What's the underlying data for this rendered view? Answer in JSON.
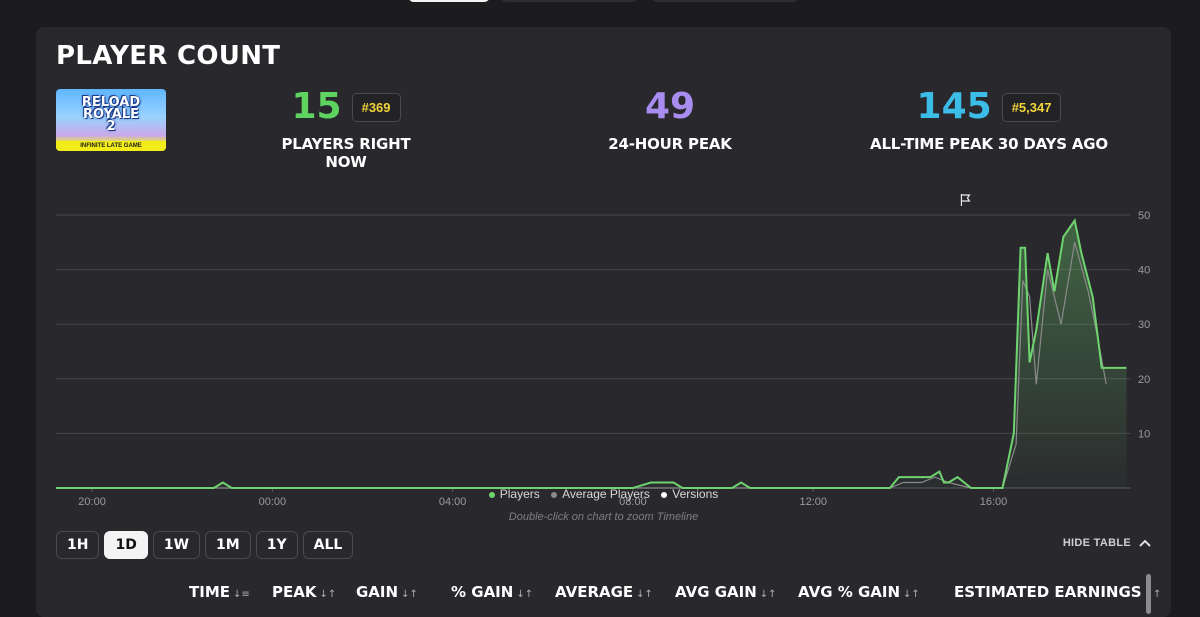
{
  "top_tabs": [
    {
      "active": true
    },
    {
      "active": false
    },
    {
      "active": false
    }
  ],
  "card": {
    "title": "PLAYER COUNT",
    "thumbnail": {
      "title_line1": "RELOAD",
      "title_line2": "ROYALE",
      "title_line3": "2",
      "subtitle": "INFINITE LATE GAME"
    }
  },
  "stats": {
    "now": {
      "value": "15",
      "rank": "#369",
      "label": "PLAYERS RIGHT NOW",
      "color": "#5fd35f"
    },
    "peak24": {
      "value": "49",
      "label": "24-HOUR PEAK",
      "color": "#a98cf0"
    },
    "alltime": {
      "value": "145",
      "rank": "#5,347",
      "label": "ALL-TIME PEAK 30 DAYS AGO",
      "color": "#3bbde8"
    }
  },
  "legend": {
    "players": "Players",
    "average": "Average Players",
    "versions": "Versions"
  },
  "hint": "Double-click on chart to zoom Timeline",
  "ranges": [
    "1H",
    "1D",
    "1W",
    "1M",
    "1Y",
    "ALL"
  ],
  "active_range": "1D",
  "hide_table": "HIDE TABLE",
  "columns": [
    "TIME",
    "PEAK",
    "GAIN",
    "% GAIN",
    "AVERAGE",
    "AVG GAIN",
    "AVG % GAIN",
    "ESTIMATED EARNINGS"
  ],
  "chart_data": {
    "type": "line",
    "ylim": [
      0,
      50
    ],
    "yticks": [
      10,
      20,
      30,
      40,
      50
    ],
    "xticks": [
      "20:00",
      "00:00",
      "04:00",
      "08:00",
      "12:00",
      "16:00"
    ],
    "xrange_hours": [
      19.17,
      19.0
    ],
    "series": [
      {
        "name": "Players",
        "color": "#6fd46f",
        "x": [
          19.2,
          20,
          21,
          22.7,
          22.9,
          23.1,
          24,
          28,
          32,
          32.4,
          32.5,
          32.9,
          33.1,
          33.3,
          34.2,
          34.4,
          34.6,
          36,
          37.7,
          37.9,
          38.3,
          38.6,
          38.8,
          38.9,
          39,
          39.2,
          39.5,
          40.2,
          40.45,
          40.6,
          40.7,
          40.8,
          40.95,
          41.2,
          41.35,
          41.55,
          41.8,
          41.95,
          42.2,
          42.4,
          42.6,
          42.85,
          42.95
        ],
        "y": [
          0,
          0,
          0,
          0,
          1,
          0,
          0,
          0,
          0,
          1,
          1,
          1,
          0,
          0,
          0,
          1,
          0,
          0,
          0,
          2,
          2,
          2,
          3,
          1,
          1,
          2,
          0,
          0,
          10,
          44,
          44,
          23,
          29,
          43,
          36,
          46,
          49,
          43,
          35,
          22,
          22,
          22,
          22
        ]
      },
      {
        "name": "Average Players",
        "color": "#8a8a8a",
        "x": [
          19.2,
          24,
          32,
          37.7,
          38,
          38.4,
          38.7,
          39,
          39.5,
          40.2,
          40.5,
          40.65,
          40.8,
          40.95,
          41.2,
          41.5,
          41.8,
          42.1,
          42.3,
          42.5
        ],
        "y": [
          0,
          0,
          0,
          0,
          1,
          1,
          2,
          1,
          0,
          0,
          8,
          38,
          35,
          19,
          40,
          30,
          45,
          36,
          28,
          19
        ]
      }
    ],
    "version_markers_hours": [
      38.8
    ]
  }
}
